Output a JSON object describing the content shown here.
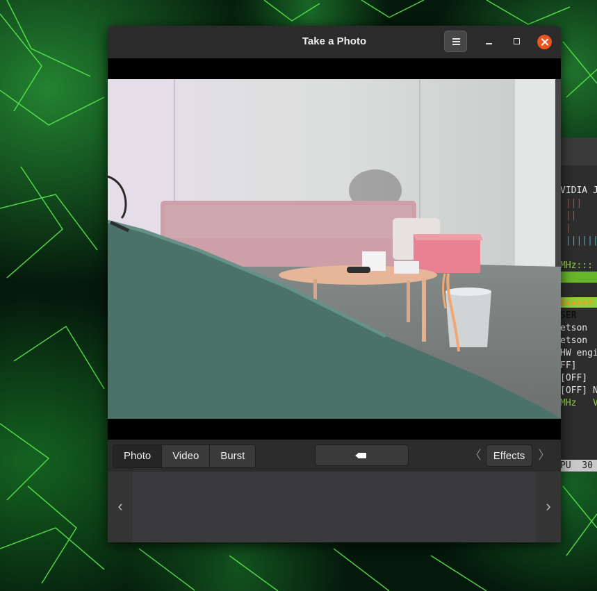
{
  "window": {
    "title": "Take a Photo"
  },
  "background_terminal": {
    "lines": [
      "VIDIA J",
      " |||",
      " ||",
      " |",
      " ||||||",
      "",
      "MHz:::",
      "",
      "",
      "######",
      "SER",
      "etson",
      "etson",
      "HW engi",
      "FF]",
      "[OFF]",
      "[OFF] N",
      "MHz   V"
    ],
    "footer": "PU  30"
  },
  "modes": {
    "photo": "Photo",
    "video": "Video",
    "burst": "Burst",
    "active": "photo"
  },
  "effects": {
    "label": "Effects",
    "prev_glyph": "〈",
    "next_glyph": "〉"
  },
  "gallery": {
    "prev_glyph": "‹",
    "next_glyph": "›"
  },
  "colors": {
    "close": "#e95420",
    "accent_green": "#67b52b"
  },
  "icons": [
    "menu-icon",
    "minimize-icon",
    "maximize-icon",
    "close-icon",
    "video-camera-icon"
  ]
}
